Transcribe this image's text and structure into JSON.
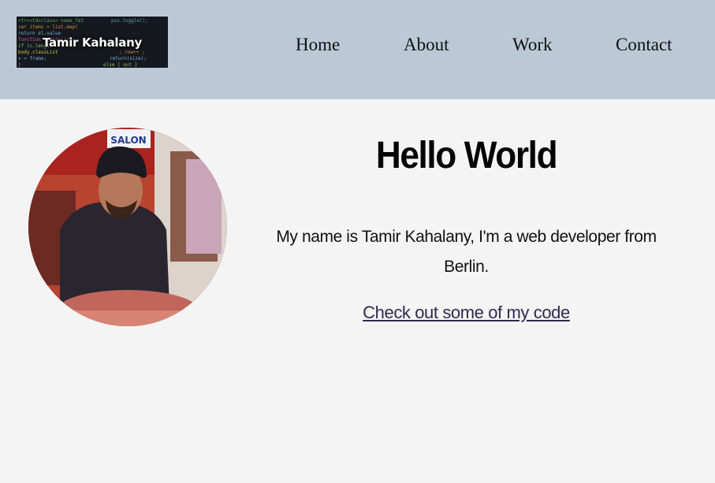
{
  "header": {
    "logo_text": "Tamir Kahalany",
    "background_color": "#bac9d5",
    "nav": [
      {
        "label": "Home"
      },
      {
        "label": "About"
      },
      {
        "label": "Work"
      },
      {
        "label": "Contact"
      }
    ]
  },
  "hero": {
    "title": "Hello World",
    "intro": "My name is Tamir Kahalany, I'm a web developer from Berlin.",
    "link_label": "Check out some of my code",
    "photo_sign_text": "SALON",
    "link_color": "#2f2a4f"
  }
}
